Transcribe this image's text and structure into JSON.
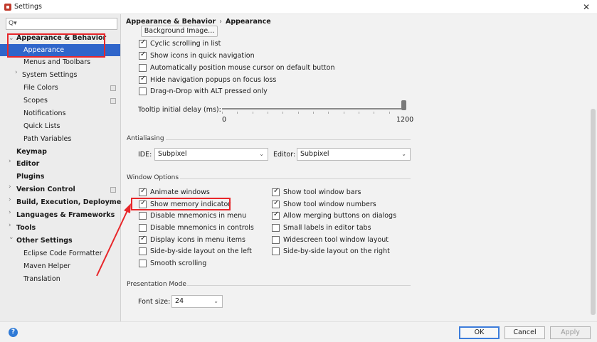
{
  "window": {
    "title": "Settings"
  },
  "search": {
    "placeholder": ""
  },
  "sidebar": {
    "items": [
      {
        "label": "Appearance & Behavior",
        "bold": true
      },
      {
        "label": "Appearance",
        "selected": true
      },
      {
        "label": "Menus and Toolbars"
      },
      {
        "label": "System Settings"
      },
      {
        "label": "File Colors"
      },
      {
        "label": "Scopes"
      },
      {
        "label": "Notifications"
      },
      {
        "label": "Quick Lists"
      },
      {
        "label": "Path Variables"
      },
      {
        "label": "Keymap",
        "bold": true
      },
      {
        "label": "Editor",
        "bold": true
      },
      {
        "label": "Plugins",
        "bold": true
      },
      {
        "label": "Version Control",
        "bold": true
      },
      {
        "label": "Build, Execution, Deployment",
        "bold": true
      },
      {
        "label": "Languages & Frameworks",
        "bold": true
      },
      {
        "label": "Tools",
        "bold": true
      },
      {
        "label": "Other Settings",
        "bold": true
      },
      {
        "label": "Eclipse Code Formatter"
      },
      {
        "label": "Maven Helper"
      },
      {
        "label": "Translation"
      }
    ]
  },
  "main": {
    "breadcrumb": [
      "Appearance & Behavior",
      "Appearance"
    ],
    "breadcrumb_sep": "›",
    "background_image_button": "Background Image...",
    "ui_options": [
      {
        "label": "Cyclic scrolling in list",
        "checked": true
      },
      {
        "label": "Show icons in quick navigation",
        "checked": true
      },
      {
        "label": "Automatically position mouse cursor on default button",
        "checked": false
      },
      {
        "label": "Hide navigation popups on focus loss",
        "checked": true
      },
      {
        "label": "Drag-n-Drop with ALT pressed only",
        "checked": false
      }
    ],
    "tooltip": {
      "label": "Tooltip initial delay (ms):",
      "min_label": "0",
      "max_label": "1200",
      "value": 1200
    },
    "antialiasing": {
      "title": "Antialiasing",
      "ide_label": "IDE:",
      "ide_value": "Subpixel",
      "editor_label": "Editor:",
      "editor_value": "Subpixel"
    },
    "window_options": {
      "title": "Window Options",
      "left": [
        {
          "label": "Animate windows",
          "checked": true
        },
        {
          "label": "Show memory indicator",
          "checked": true
        },
        {
          "label": "Disable mnemonics in menu",
          "checked": false
        },
        {
          "label": "Disable mnemonics in controls",
          "checked": false
        },
        {
          "label": "Display icons in menu items",
          "checked": true
        },
        {
          "label": "Side-by-side layout on the left",
          "checked": false
        },
        {
          "label": "Smooth scrolling",
          "checked": false
        }
      ],
      "right": [
        {
          "label": "Show tool window bars",
          "checked": true
        },
        {
          "label": "Show tool window numbers",
          "checked": true
        },
        {
          "label": "Allow merging buttons on dialogs",
          "checked": true
        },
        {
          "label": "Small labels in editor tabs",
          "checked": false
        },
        {
          "label": "Widescreen tool window layout",
          "checked": false
        },
        {
          "label": "Side-by-side layout on the right",
          "checked": false
        }
      ]
    },
    "presentation": {
      "title": "Presentation Mode",
      "font_size_label": "Font size:",
      "font_size_value": "24"
    }
  },
  "footer": {
    "help": "?",
    "ok": "OK",
    "cancel": "Cancel",
    "apply": "Apply"
  },
  "icons": {
    "search": "search-icon",
    "close": "close-icon",
    "help": "help-icon",
    "dropdown": "chevron-down-icon",
    "expand": "chevron-right-icon"
  },
  "colors": {
    "selection": "#2f65ca",
    "annotation": "#e8262a",
    "ok_border": "#3d7ddb"
  }
}
